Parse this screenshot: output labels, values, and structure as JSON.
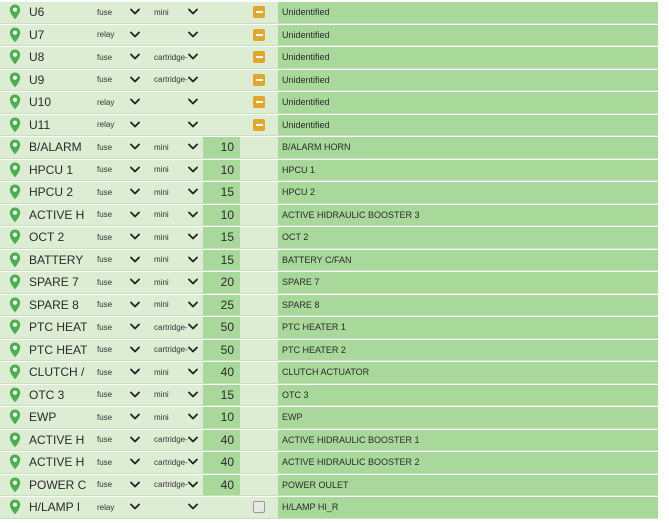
{
  "colors": {
    "row_bg": "#ddedd3",
    "desc_bg": "#a9d99a",
    "pin_green": "#4caf50",
    "indeterminate": "#e3a52b"
  },
  "rows": [
    {
      "name": "U6",
      "type": "fuse",
      "sub": "mini",
      "rating": "",
      "check": "indeterminate",
      "desc": "Unidentified"
    },
    {
      "name": "U7",
      "type": "relay",
      "sub": "",
      "rating": "",
      "check": "indeterminate",
      "desc": "Unidentified"
    },
    {
      "name": "U8",
      "type": "fuse",
      "sub": "cartridge-",
      "rating": "",
      "check": "indeterminate",
      "desc": "Unidentified"
    },
    {
      "name": "U9",
      "type": "fuse",
      "sub": "cartridge-",
      "rating": "",
      "check": "indeterminate",
      "desc": "Unidentified"
    },
    {
      "name": "U10",
      "type": "relay",
      "sub": "",
      "rating": "",
      "check": "indeterminate",
      "desc": "Unidentified"
    },
    {
      "name": "U11",
      "type": "relay",
      "sub": "",
      "rating": "",
      "check": "indeterminate",
      "desc": "Unidentified"
    },
    {
      "name": "B/ALARM",
      "type": "fuse",
      "sub": "mini",
      "rating": "10",
      "check": "none",
      "desc": "B/ALARM HORN"
    },
    {
      "name": "HPCU 1",
      "type": "fuse",
      "sub": "mini",
      "rating": "10",
      "check": "none",
      "desc": "HPCU 1"
    },
    {
      "name": "HPCU 2",
      "type": "fuse",
      "sub": "mini",
      "rating": "15",
      "check": "none",
      "desc": "HPCU 2"
    },
    {
      "name": "ACTIVE H",
      "type": "fuse",
      "sub": "mini",
      "rating": "10",
      "check": "none",
      "desc": "ACTIVE HIDRAULIC BOOSTER 3"
    },
    {
      "name": "OCT 2",
      "type": "fuse",
      "sub": "mini",
      "rating": "15",
      "check": "none",
      "desc": "OCT 2"
    },
    {
      "name": "BATTERY",
      "type": "fuse",
      "sub": "mini",
      "rating": "15",
      "check": "none",
      "desc": "BATTERY C/FAN"
    },
    {
      "name": "SPARE 7",
      "type": "fuse",
      "sub": "mini",
      "rating": "20",
      "check": "none",
      "desc": "SPARE 7"
    },
    {
      "name": "SPARE 8",
      "type": "fuse",
      "sub": "mini",
      "rating": "25",
      "check": "none",
      "desc": "SPARE 8"
    },
    {
      "name": "PTC HEAT",
      "type": "fuse",
      "sub": "cartridge-",
      "rating": "50",
      "check": "none",
      "desc": "PTC HEATER 1"
    },
    {
      "name": "PTC HEAT",
      "type": "fuse",
      "sub": "cartridge-",
      "rating": "50",
      "check": "none",
      "desc": "PTC HEATER 2"
    },
    {
      "name": "CLUTCH /",
      "type": "fuse",
      "sub": "mini",
      "rating": "40",
      "check": "none",
      "desc": "CLUTCH ACTUATOR"
    },
    {
      "name": "OTC 3",
      "type": "fuse",
      "sub": "mini",
      "rating": "15",
      "check": "none",
      "desc": "OTC 3"
    },
    {
      "name": "EWP",
      "type": "fuse",
      "sub": "mini",
      "rating": "10",
      "check": "none",
      "desc": "EWP"
    },
    {
      "name": "ACTIVE H",
      "type": "fuse",
      "sub": "cartridge-",
      "rating": "40",
      "check": "none",
      "desc": "ACTIVE HIDRAULIC BOOSTER 1"
    },
    {
      "name": "ACTIVE H",
      "type": "fuse",
      "sub": "cartridge-",
      "rating": "40",
      "check": "none",
      "desc": "ACTIVE HIDRAULIC BOOSTER 2"
    },
    {
      "name": "POWER C",
      "type": "fuse",
      "sub": "cartridge-",
      "rating": "40",
      "check": "none",
      "desc": "POWER OULET"
    },
    {
      "name": "H/LAMP I",
      "type": "relay",
      "sub": "",
      "rating": "",
      "check": "unchecked",
      "desc": "H/LAMP HI_R"
    }
  ]
}
